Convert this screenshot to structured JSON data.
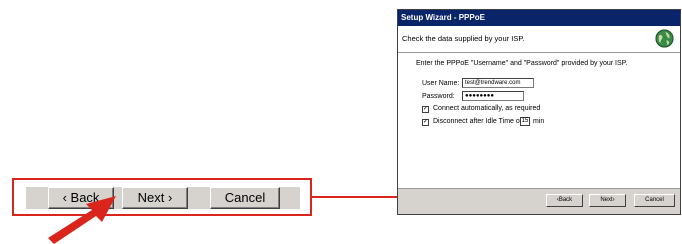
{
  "callout": {
    "back_label": "‹ Back",
    "next_label": "Next ›",
    "cancel_label": "Cancel"
  },
  "dialog": {
    "title": "Setup Wizard - PPPoE",
    "header_text": "Check the data supplied by your ISP.",
    "instructions": "Enter the PPPoE \"Username\" and \"Password\" provided by your ISP.",
    "username_label": "User Name:",
    "username_value": "test@trendware.com",
    "password_label": "Password:",
    "password_value": "●●●●●●●●",
    "connect_auto_label": "Connect automatically, as required",
    "connect_auto_checked": true,
    "disconnect_prefix": "Disconnect after Idle Time of",
    "idle_minutes": "15",
    "idle_unit": "min",
    "disconnect_checked": true,
    "back_label": "‹Back",
    "next_label": "Next›",
    "cancel_label": "Cancel"
  },
  "colors": {
    "annotation_red": "#d9251c",
    "titlebar": "#0a246a",
    "dialog_face": "#d6d3ce"
  },
  "icons": {
    "header_icon": "globe-icon",
    "pointer": "arrow-pointer-icon"
  }
}
